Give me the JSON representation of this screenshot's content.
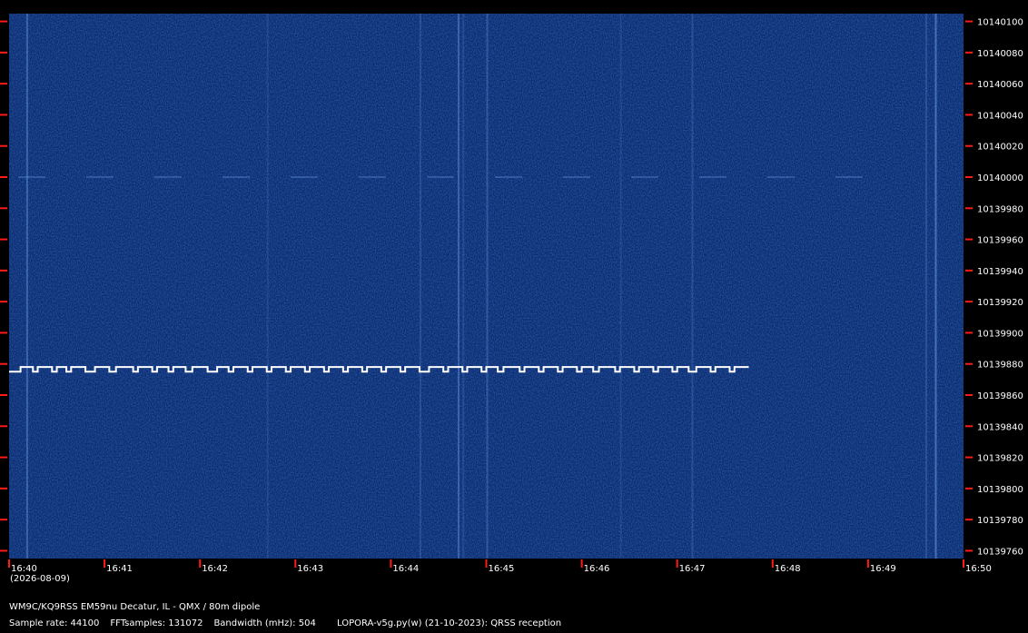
{
  "chart_data": {
    "type": "heatmap",
    "title": "",
    "xlabel": "",
    "ylabel": "",
    "x_tick_labels": [
      "16:40",
      "16:41",
      "16:42",
      "16:43",
      "16:44",
      "16:45",
      "16:46",
      "16:47",
      "16:48",
      "16:49",
      "16:50"
    ],
    "date_label": "(2026-08-09)",
    "y_tick_labels": [
      "10140100",
      "10140080",
      "10140060",
      "10140040",
      "10140020",
      "10140000",
      "10139980",
      "10139960",
      "10139940",
      "10139920",
      "10139900",
      "10139880",
      "10139860",
      "10139840",
      "10139820",
      "10139800",
      "10139780",
      "10139760"
    ],
    "xlim": [
      "16:40",
      "16:50"
    ],
    "ylim": [
      10139755,
      10140105
    ],
    "signal": {
      "base_freq": 10139875,
      "shift_freq": 10139878,
      "start": "16:40",
      "end": "16:47.75",
      "segments_minutes": [
        [
          0.0,
          0.12,
          0
        ],
        [
          0.12,
          0.25,
          1
        ],
        [
          0.25,
          0.3,
          0
        ],
        [
          0.3,
          0.45,
          1
        ],
        [
          0.45,
          0.5,
          0
        ],
        [
          0.5,
          0.6,
          1
        ],
        [
          0.6,
          0.65,
          0
        ],
        [
          0.65,
          0.8,
          1
        ],
        [
          0.8,
          0.9,
          0
        ],
        [
          0.9,
          1.05,
          1
        ],
        [
          1.05,
          1.12,
          0
        ],
        [
          1.12,
          1.3,
          1
        ],
        [
          1.3,
          1.35,
          0
        ],
        [
          1.35,
          1.5,
          1
        ],
        [
          1.5,
          1.55,
          0
        ],
        [
          1.55,
          1.67,
          1
        ],
        [
          1.67,
          1.72,
          0
        ],
        [
          1.72,
          1.85,
          1
        ],
        [
          1.85,
          1.92,
          0
        ],
        [
          1.92,
          2.08,
          1
        ],
        [
          2.08,
          2.18,
          0
        ],
        [
          2.18,
          2.3,
          1
        ],
        [
          2.3,
          2.35,
          0
        ],
        [
          2.35,
          2.5,
          1
        ],
        [
          2.5,
          2.55,
          0
        ],
        [
          2.55,
          2.7,
          1
        ],
        [
          2.7,
          2.75,
          0
        ],
        [
          2.75,
          2.9,
          1
        ],
        [
          2.9,
          2.95,
          0
        ],
        [
          2.95,
          3.1,
          1
        ],
        [
          3.1,
          3.15,
          0
        ],
        [
          3.15,
          3.3,
          1
        ],
        [
          3.3,
          3.35,
          0
        ],
        [
          3.35,
          3.5,
          1
        ],
        [
          3.5,
          3.55,
          0
        ],
        [
          3.55,
          3.7,
          1
        ],
        [
          3.7,
          3.75,
          0
        ],
        [
          3.75,
          3.9,
          1
        ],
        [
          3.9,
          3.95,
          0
        ],
        [
          3.95,
          4.1,
          1
        ],
        [
          4.1,
          4.15,
          0
        ],
        [
          4.15,
          4.3,
          1
        ],
        [
          4.3,
          4.4,
          0
        ],
        [
          4.4,
          4.55,
          1
        ],
        [
          4.55,
          4.6,
          0
        ],
        [
          4.6,
          4.75,
          1
        ],
        [
          4.75,
          4.8,
          0
        ],
        [
          4.8,
          4.95,
          1
        ],
        [
          4.95,
          5.0,
          0
        ],
        [
          5.0,
          5.12,
          1
        ],
        [
          5.12,
          5.18,
          0
        ],
        [
          5.18,
          5.35,
          1
        ],
        [
          5.35,
          5.4,
          0
        ],
        [
          5.4,
          5.55,
          1
        ],
        [
          5.55,
          5.6,
          0
        ],
        [
          5.6,
          5.75,
          1
        ],
        [
          5.75,
          5.8,
          0
        ],
        [
          5.8,
          5.95,
          1
        ],
        [
          5.95,
          6.0,
          0
        ],
        [
          6.0,
          6.12,
          1
        ],
        [
          6.12,
          6.18,
          0
        ],
        [
          6.18,
          6.35,
          1
        ],
        [
          6.35,
          6.4,
          0
        ],
        [
          6.4,
          6.55,
          1
        ],
        [
          6.55,
          6.6,
          0
        ],
        [
          6.6,
          6.75,
          1
        ],
        [
          6.75,
          6.8,
          0
        ],
        [
          6.8,
          6.95,
          1
        ],
        [
          6.95,
          7.0,
          0
        ],
        [
          7.0,
          7.12,
          1
        ],
        [
          7.12,
          7.2,
          0
        ],
        [
          7.2,
          7.35,
          1
        ],
        [
          7.35,
          7.4,
          0
        ],
        [
          7.4,
          7.55,
          1
        ],
        [
          7.55,
          7.6,
          0
        ],
        [
          7.6,
          7.75,
          1
        ]
      ]
    },
    "background_color": "#0a2a6e",
    "signal_color": "#ffffff",
    "tick_color": "#ff1a1a"
  },
  "footer": {
    "station": "WM9C/KQ9RSS EM59nu Decatur, IL - QMX / 80m dipole",
    "sample_rate": "Sample rate: 44100",
    "fft_samples": "FFTsamples: 131072",
    "bandwidth": "Bandwidth (mHz): 504",
    "software": "LOPORA-v5g.py(w) (21-10-2023): QRSS reception"
  }
}
